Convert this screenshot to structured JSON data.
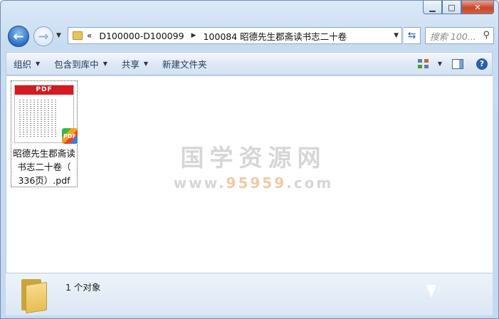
{
  "window": {
    "minimize_glyph": "▁",
    "maximize_glyph": "□",
    "close_glyph": "✕"
  },
  "nav": {
    "back_glyph": "←",
    "forward_glyph": "→",
    "address": {
      "prefix": "«",
      "crumb1": "D100000-D100099",
      "crumb2": "100084 昭德先生郡斋读书志二十卷"
    },
    "search_placeholder": "搜索 100..."
  },
  "toolbar": {
    "organize": "组织",
    "include_library": "包含到库中",
    "share": "共享",
    "new_folder": "新建文件夹"
  },
  "files": [
    {
      "name": "昭德先生郡斋读书志二十卷（336页）.pdf",
      "name_line1": "昭德先生郡斋读",
      "name_line2": "书志二十卷（",
      "name_line3": "336页）.pdf",
      "thumb_header": "PDF",
      "badge": "PDF"
    }
  ],
  "watermark": {
    "title": "国学资源网",
    "url_prefix": "www.",
    "url_highlight": "95959",
    "url_suffix": ".com"
  },
  "status": {
    "object_count": "1 个对象"
  },
  "icons": [
    "folder-icon",
    "back-arrow-icon",
    "forward-arrow-icon",
    "refresh-icon",
    "search-icon",
    "views-icon",
    "preview-pane-icon",
    "help-icon",
    "pdf-icon"
  ]
}
